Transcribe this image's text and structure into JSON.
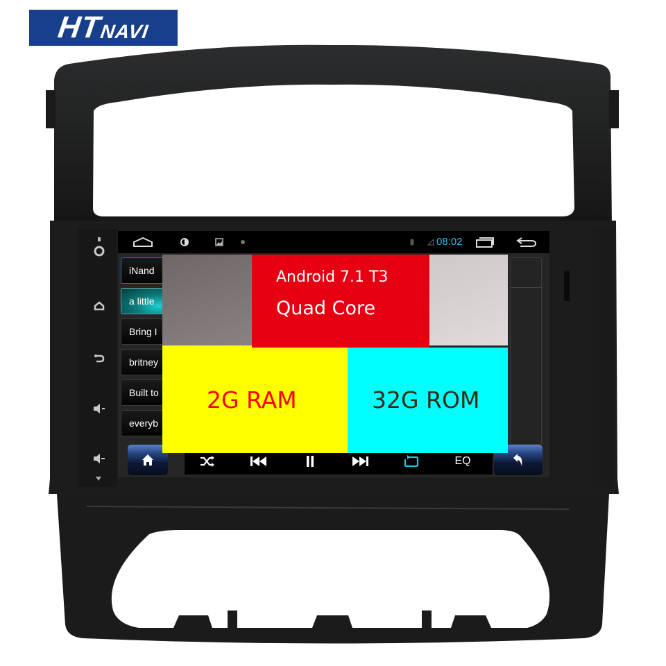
{
  "brand": {
    "logo_main": "HT",
    "logo_sub": "NAVI",
    "color": "#173f8c"
  },
  "device": {
    "hardware_buttons": [
      {
        "icon": "power-icon"
      },
      {
        "icon": "home-icon"
      },
      {
        "icon": "back-icon"
      },
      {
        "icon": "volume-up-icon"
      },
      {
        "icon": "volume-down-icon"
      }
    ]
  },
  "statusbar": {
    "nav_home_icon": "home-outline-icon",
    "brightness_icon": "brightness-icon",
    "gallery_icon": "image-icon",
    "dot_icon": "notification-dot-icon",
    "bluetooth_icon": "bluetooth-icon",
    "signal_icon": "signal-icon",
    "time": "08:02",
    "time_color": "#2fb8e8",
    "recent_apps_icon": "recent-apps-icon",
    "back_icon": "back-arrow-icon"
  },
  "playlist": {
    "items": [
      {
        "label": "iNand"
      },
      {
        "label": "a little"
      },
      {
        "label": "Bring I"
      },
      {
        "label": "britney"
      },
      {
        "label": "Built to"
      },
      {
        "label": "everyb"
      }
    ],
    "active_index": 1,
    "active_color": "#1dd3d3"
  },
  "controls": {
    "home_button_icon": "home-icon",
    "shuffle_icon": "shuffle-icon",
    "prev_icon": "skip-previous-icon",
    "pause_icon": "pause-icon",
    "next_icon": "skip-next-icon",
    "repeat_icon": "repeat-icon",
    "repeat_color": "#1ec8e0",
    "eq_label": "EQ",
    "back_button_icon": "undo-icon"
  },
  "promo": {
    "line1": "Android 7.1  T3",
    "line2": "Quad Core",
    "ram": "2G RAM",
    "rom": "32G ROM",
    "colors": {
      "red": "#e60012",
      "yellow": "#ffff00",
      "cyan": "#00ffff",
      "ram_text": "#ff0000",
      "rom_text": "#3a2a14"
    }
  }
}
